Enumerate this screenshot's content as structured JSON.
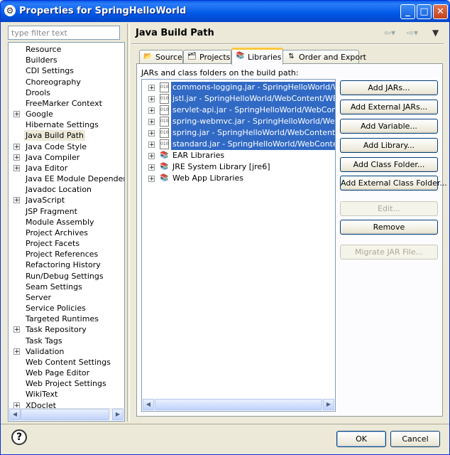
{
  "window": {
    "title": "Properties for SpringHelloWorld"
  },
  "filter": {
    "placeholder": "type filter text"
  },
  "nav": {
    "items": [
      {
        "label": "Resource",
        "expandable": false
      },
      {
        "label": "Builders",
        "expandable": false
      },
      {
        "label": "CDI Settings",
        "expandable": false
      },
      {
        "label": "Choreography",
        "expandable": false
      },
      {
        "label": "Drools",
        "expandable": false
      },
      {
        "label": "FreeMarker Context",
        "expandable": false
      },
      {
        "label": "Google",
        "expandable": true
      },
      {
        "label": "Hibernate Settings",
        "expandable": false
      },
      {
        "label": "Java Build Path",
        "expandable": false,
        "selected": true
      },
      {
        "label": "Java Code Style",
        "expandable": true
      },
      {
        "label": "Java Compiler",
        "expandable": true
      },
      {
        "label": "Java Editor",
        "expandable": true
      },
      {
        "label": "Java EE Module Dependencies",
        "expandable": false
      },
      {
        "label": "Javadoc Location",
        "expandable": false
      },
      {
        "label": "JavaScript",
        "expandable": true
      },
      {
        "label": "JSP Fragment",
        "expandable": false
      },
      {
        "label": "Module Assembly",
        "expandable": false
      },
      {
        "label": "Project Archives",
        "expandable": false
      },
      {
        "label": "Project Facets",
        "expandable": false
      },
      {
        "label": "Project References",
        "expandable": false
      },
      {
        "label": "Refactoring History",
        "expandable": false
      },
      {
        "label": "Run/Debug Settings",
        "expandable": false
      },
      {
        "label": "Seam Settings",
        "expandable": false
      },
      {
        "label": "Server",
        "expandable": false
      },
      {
        "label": "Service Policies",
        "expandable": false
      },
      {
        "label": "Targeted Runtimes",
        "expandable": false
      },
      {
        "label": "Task Repository",
        "expandable": true
      },
      {
        "label": "Task Tags",
        "expandable": false
      },
      {
        "label": "Validation",
        "expandable": true
      },
      {
        "label": "Web Content Settings",
        "expandable": false
      },
      {
        "label": "Web Page Editor",
        "expandable": false
      },
      {
        "label": "Web Project Settings",
        "expandable": false
      },
      {
        "label": "WikiText",
        "expandable": false
      },
      {
        "label": "XDoclet",
        "expandable": true
      }
    ]
  },
  "page": {
    "title": "Java Build Path"
  },
  "tabs": [
    {
      "label": "Source",
      "icon": "source-folder-icon"
    },
    {
      "label": "Projects",
      "icon": "projects-icon"
    },
    {
      "label": "Libraries",
      "icon": "libraries-icon",
      "active": true
    },
    {
      "label": "Order and Export",
      "icon": "order-export-icon"
    }
  ],
  "libraries": {
    "header": "JARs and class folders on the build path:",
    "entries": [
      {
        "label": "commons-logging.jar - SpringHelloWorld/WebContent/WEB-INF/lib",
        "kind": "jar",
        "selected": true
      },
      {
        "label": "jstl.jar - SpringHelloWorld/WebContent/WEB-INF/lib",
        "kind": "jar",
        "selected": true
      },
      {
        "label": "servlet-api.jar - SpringHelloWorld/WebContent/WEB-INF/lib",
        "kind": "jar",
        "selected": true
      },
      {
        "label": "spring-webmvc.jar - SpringHelloWorld/WebContent/WEB-INF/lib",
        "kind": "jar",
        "selected": true
      },
      {
        "label": "spring.jar - SpringHelloWorld/WebContent/WEB-INF/lib",
        "kind": "jar",
        "selected": true
      },
      {
        "label": "standard.jar - SpringHelloWorld/WebContent/WEB-INF/lib",
        "kind": "jar",
        "selected": true
      },
      {
        "label": "EAR Libraries",
        "kind": "library",
        "selected": false
      },
      {
        "label": "JRE System Library [jre6]",
        "kind": "library",
        "selected": false
      },
      {
        "label": "Web App Libraries",
        "kind": "library",
        "selected": false
      }
    ]
  },
  "buttons": [
    {
      "label": "Add JARs...",
      "enabled": true
    },
    {
      "label": "Add External JARs...",
      "enabled": true
    },
    {
      "label": "Add Variable...",
      "enabled": true
    },
    {
      "label": "Add Library...",
      "enabled": true
    },
    {
      "label": "Add Class Folder...",
      "enabled": true
    },
    {
      "label": "Add External Class Folder...",
      "enabled": true
    },
    {
      "label": "Edit...",
      "enabled": false
    },
    {
      "label": "Remove",
      "enabled": true
    },
    {
      "label": "Migrate JAR File...",
      "enabled": false
    }
  ],
  "footer": {
    "ok_label": "OK",
    "cancel_label": "Cancel"
  },
  "colors": {
    "selection": "#316ac5",
    "titlebar": "#0058e6",
    "tab_highlight": "#ffc73c"
  }
}
